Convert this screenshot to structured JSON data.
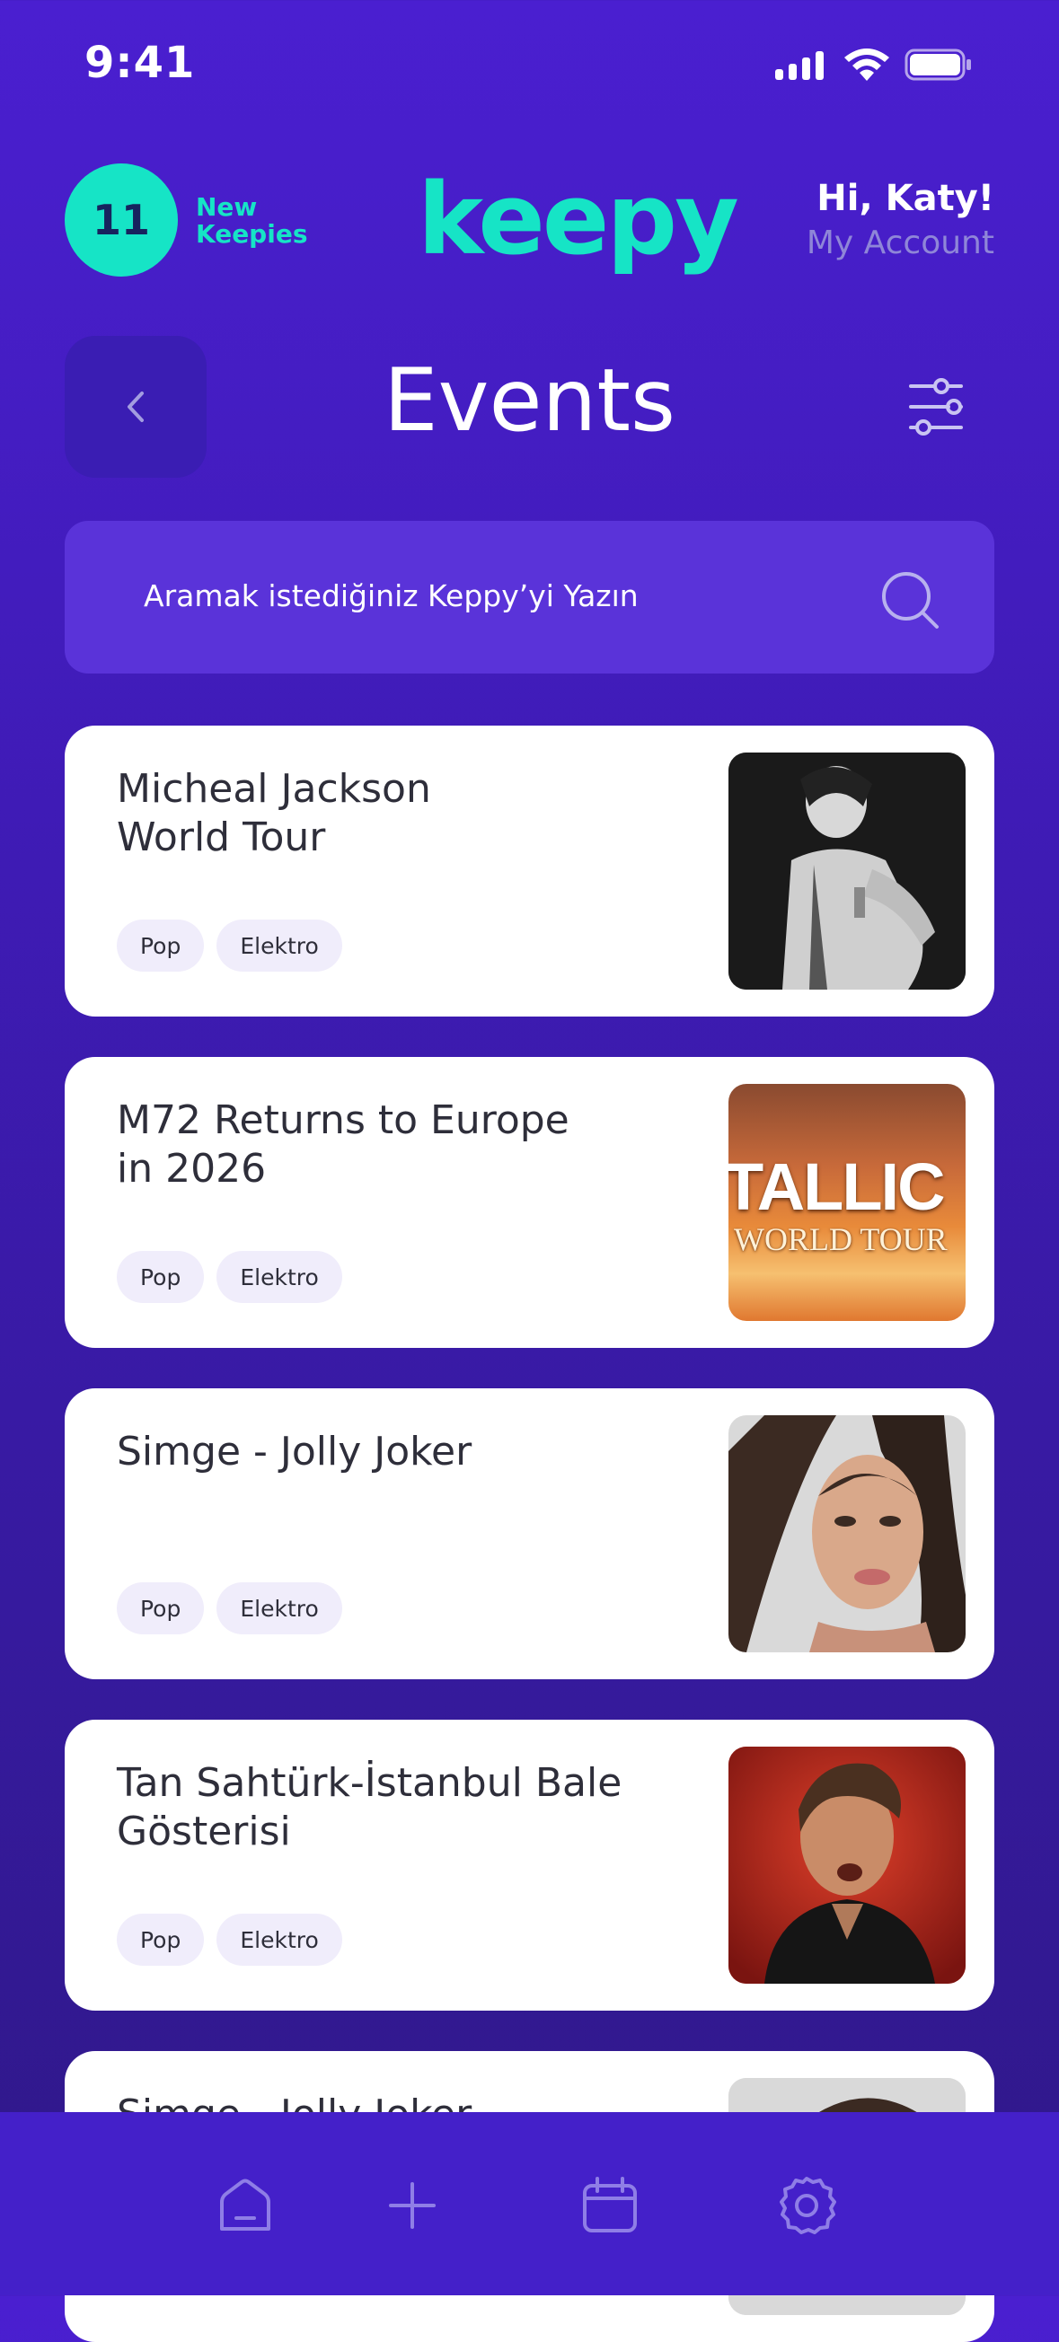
{
  "status_bar": {
    "time": "9:41"
  },
  "header": {
    "new_count": "11",
    "new_label_line1": "New",
    "new_label_line2": "Keepies",
    "logo": "keepy",
    "greeting": "Hi, Katy!",
    "account_link": "My Account"
  },
  "page": {
    "title": "Events"
  },
  "search": {
    "placeholder": "Aramak istediğiniz Keppy’yi Yazın"
  },
  "events": [
    {
      "title_line1": "Micheal Jackson",
      "title_line2": "World Tour",
      "tags": [
        "Pop",
        "Elektro"
      ]
    },
    {
      "title_line1": "M72 Returns to Europe",
      "title_line2": "in 2026",
      "tags": [
        "Pop",
        "Elektro"
      ],
      "image_text": [
        "TALLIC",
        "WORLD TOUR"
      ]
    },
    {
      "title_line1": "Simge - Jolly Joker",
      "title_line2": "",
      "tags": [
        "Pop",
        "Elektro"
      ]
    },
    {
      "title_line1": "Tan Sahtürk-İstanbul Bale",
      "title_line2": "Gösterisi",
      "tags": [
        "Pop",
        "Elektro"
      ]
    },
    {
      "title_line1": "Simge - Jolly Joker",
      "title_line2": "",
      "tags": []
    }
  ],
  "nav": {
    "icons": [
      "home-icon",
      "plus-icon",
      "calendar-icon",
      "settings-icon"
    ]
  },
  "colors": {
    "accent": "#16e4c6",
    "background": "#4a1fd0",
    "card": "#ffffff",
    "nav": "#4420c9"
  }
}
